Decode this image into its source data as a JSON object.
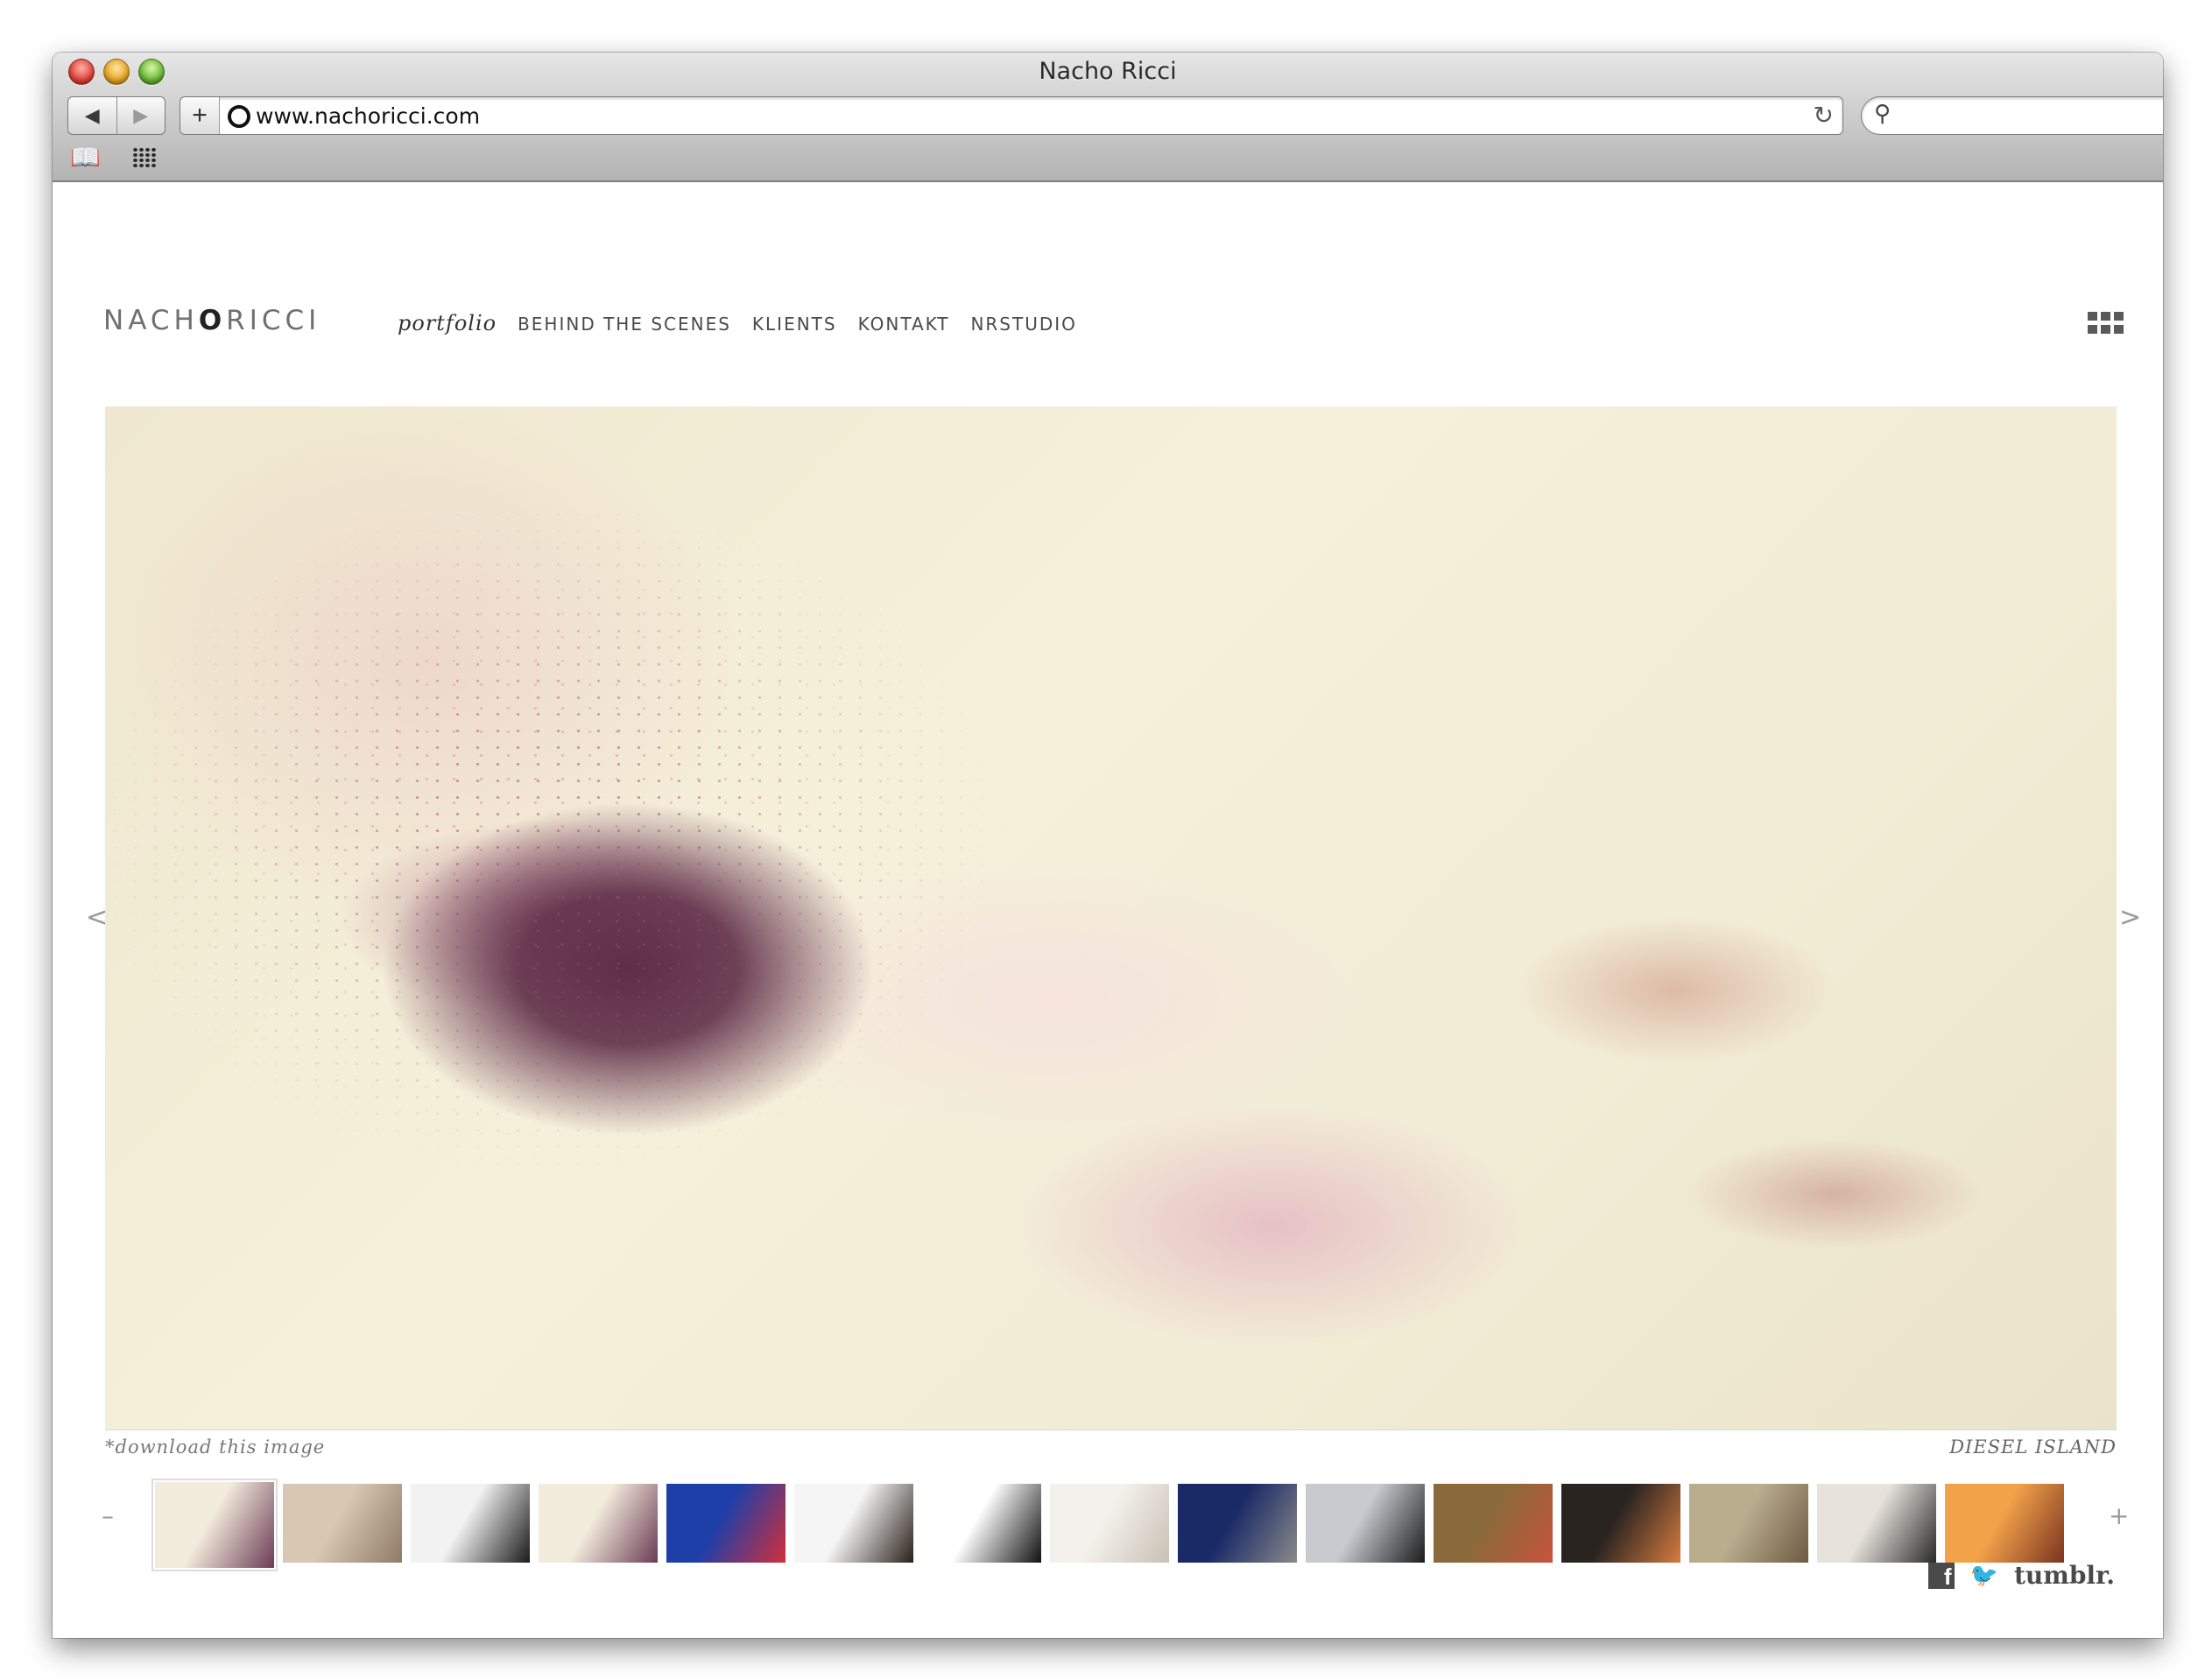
{
  "browser": {
    "window_title": "Nacho Ricci",
    "url": "www.nachoricci.com",
    "add_label": "+",
    "back_icon": "back-arrow-icon",
    "forward_icon": "forward-arrow-icon",
    "reload_icon": "reload-icon",
    "search_icon": "search-icon",
    "bookmarks_icon": "open-book-icon",
    "top_sites_icon": "grid-icon",
    "search_placeholder": ""
  },
  "site": {
    "logo_prefix": "NACH",
    "logo_o": "O",
    "logo_suffix": "RICCI",
    "nav": [
      {
        "label": "portfolio",
        "active": true
      },
      {
        "label": "BEHIND THE SCENES",
        "active": false
      },
      {
        "label": "KLIENTS",
        "active": false
      },
      {
        "label": "KONTAKT",
        "active": false
      },
      {
        "label": "NRSTUDIO",
        "active": false
      }
    ],
    "grid_menu_icon": "grid-menu-icon",
    "gallery": {
      "prev_label": "<",
      "next_label": ">",
      "download_label": "*download this image",
      "title": "DIESEL ISLAND",
      "collapse_label": "–",
      "expand_label": "+"
    },
    "thumbnails": [
      {
        "c1": "#f3ecdc",
        "c2": "#6b3b55",
        "active": true
      },
      {
        "c1": "#d8c7b2",
        "c2": "#8f7a66",
        "active": false
      },
      {
        "c1": "#f2f2f2",
        "c2": "#1a1a1a",
        "active": false
      },
      {
        "c1": "#f3ecdc",
        "c2": "#6b3b55",
        "active": false
      },
      {
        "c1": "#1e3fa8",
        "c2": "#d22f3a",
        "active": false
      },
      {
        "c1": "#f5f5f5",
        "c2": "#2a201a",
        "active": false
      },
      {
        "c1": "#ffffff",
        "c2": "#111111",
        "active": false
      },
      {
        "c1": "#f4f1ec",
        "c2": "#c8c0b4",
        "active": false
      },
      {
        "c1": "#1a2a66",
        "c2": "#8a8a8a",
        "active": false
      },
      {
        "c1": "#c8cad0",
        "c2": "#1b1b1b",
        "active": false
      },
      {
        "c1": "#8a6a3a",
        "c2": "#c7533c",
        "active": false
      },
      {
        "c1": "#2a2420",
        "c2": "#d77b3f",
        "active": false
      },
      {
        "c1": "#b9ad8e",
        "c2": "#6e5a43",
        "active": false
      },
      {
        "c1": "#e7e2dc",
        "c2": "#2a2a2a",
        "active": false
      },
      {
        "c1": "#f2a34a",
        "c2": "#7a3320",
        "active": false
      }
    ],
    "social": {
      "facebook_icon": "facebook-icon",
      "facebook_glyph": "f",
      "twitter_icon": "twitter-bird-icon",
      "tumblr_label": "tumblr."
    }
  }
}
